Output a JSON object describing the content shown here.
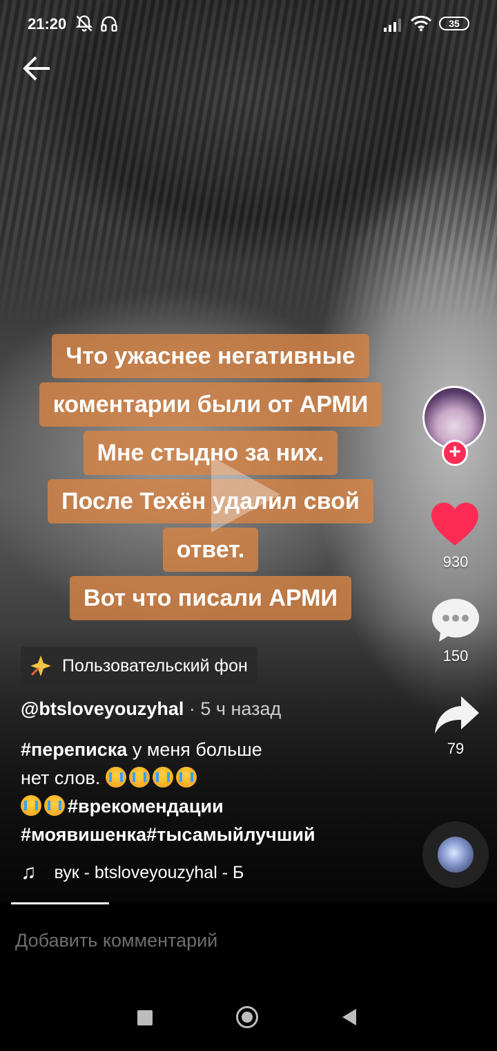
{
  "status_bar": {
    "time": "21:20",
    "battery": "35",
    "icons": [
      "bell-off-icon",
      "headphones-icon",
      "signal-icon",
      "wifi-icon",
      "battery-icon"
    ]
  },
  "video": {
    "caption_lines": [
      "Что ужаснее негативные",
      "коментарии были от АРМИ",
      "Мне стыдно за них.",
      "После Техён удалил свой",
      "ответ.",
      "Вот что писали АРМИ"
    ]
  },
  "sidebar": {
    "likes": "930",
    "comments": "150",
    "shares": "79"
  },
  "effect_chip": {
    "label": "Пользовательский фон"
  },
  "post": {
    "username": "@btsloveyouzyhal",
    "time_ago": " · 5 ч назад",
    "desc_tag1": "#переписка",
    "desc_text1": " у меня больше",
    "desc_text2": "нет слов. ",
    "desc_tag2": "#врекомендации",
    "desc_tag3": "#моявишенка#тысамыйлучший"
  },
  "music": {
    "label": "вук - btsloveyouzyhal - Б"
  },
  "comment_bar": {
    "placeholder": "Добавить комментарий"
  },
  "colors": {
    "accent": "#fe2c55",
    "caption_bg": "#d68446"
  }
}
